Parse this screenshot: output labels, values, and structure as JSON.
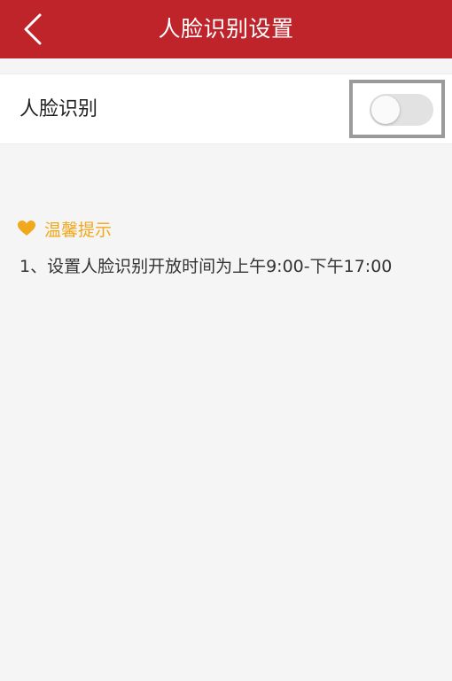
{
  "header": {
    "title": "人脸识别设置",
    "back_icon": "chevron-left-icon",
    "background_color": "#c0242b"
  },
  "setting": {
    "label": "人脸识别",
    "toggle_on": false
  },
  "tips": {
    "icon": "heart-icon",
    "icon_color": "#f0a81c",
    "title": "温馨提示",
    "items": [
      "1、设置人脸识别开放时间为上午9:00-下午17:00"
    ]
  }
}
